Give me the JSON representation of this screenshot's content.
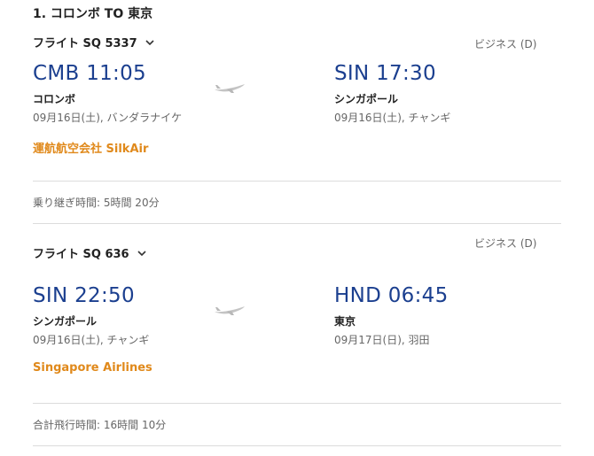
{
  "route": {
    "title": "1. コロンボ TO 東京"
  },
  "segments": [
    {
      "flight_label": "フライト SQ 5337",
      "cabin": "ビジネス (D)",
      "dep_time": "CMB 11:05",
      "dep_city": "コロンボ",
      "dep_date": "09月16日(土), バンダラナイケ",
      "arr_time": "SIN 17:30",
      "arr_city": "シンガポール",
      "arr_date": "09月16日(土), チャンギ",
      "airline": "運航航空会社 SilkAir"
    },
    {
      "flight_label": "フライト SQ 636",
      "cabin": "ビジネス (D)",
      "dep_time": "SIN 22:50",
      "dep_city": "シンガポール",
      "dep_date": "09月16日(土), チャンギ",
      "arr_time": "HND 06:45",
      "arr_city": "東京",
      "arr_date": "09月17日(日), 羽田",
      "airline": "Singapore Airlines"
    }
  ],
  "layover": "乗り継ぎ時間: 5時間 20分",
  "total": "合計飛行時間: 16時間 10分",
  "icons": {
    "plane": "plane-icon",
    "chevron": "chevron-down-icon"
  },
  "colors": {
    "time": "#1b3f8f",
    "airline": "#e0891b",
    "divider": "#dcdcdc"
  }
}
